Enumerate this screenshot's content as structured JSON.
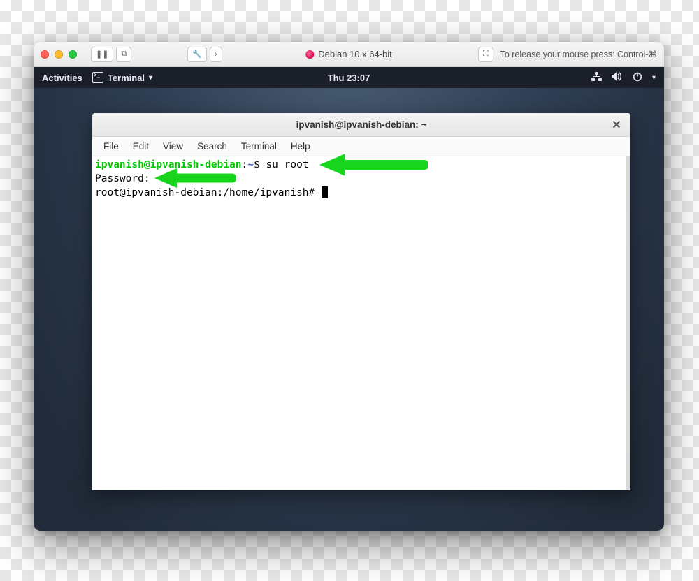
{
  "vm_toolbar": {
    "title": "Debian 10.x 64-bit",
    "mouse_hint": "To release your mouse press: Control-⌘"
  },
  "gnome": {
    "activities": "Activities",
    "app_label": "Terminal",
    "clock": "Thu 23:07"
  },
  "terminal": {
    "title": "ipvanish@ipvanish-debian: ~",
    "menu": {
      "file": "File",
      "edit": "Edit",
      "view": "View",
      "search": "Search",
      "terminal": "Terminal",
      "help": "Help"
    },
    "lines": {
      "prompt1_user": "ipvanish@ipvanish-debian",
      "prompt1_sep": ":",
      "prompt1_path": "~",
      "prompt1_tail": "$ ",
      "command1": "su root",
      "line2": "Password:",
      "line3": "root@ipvanish-debian:/home/ipvanish# "
    }
  }
}
